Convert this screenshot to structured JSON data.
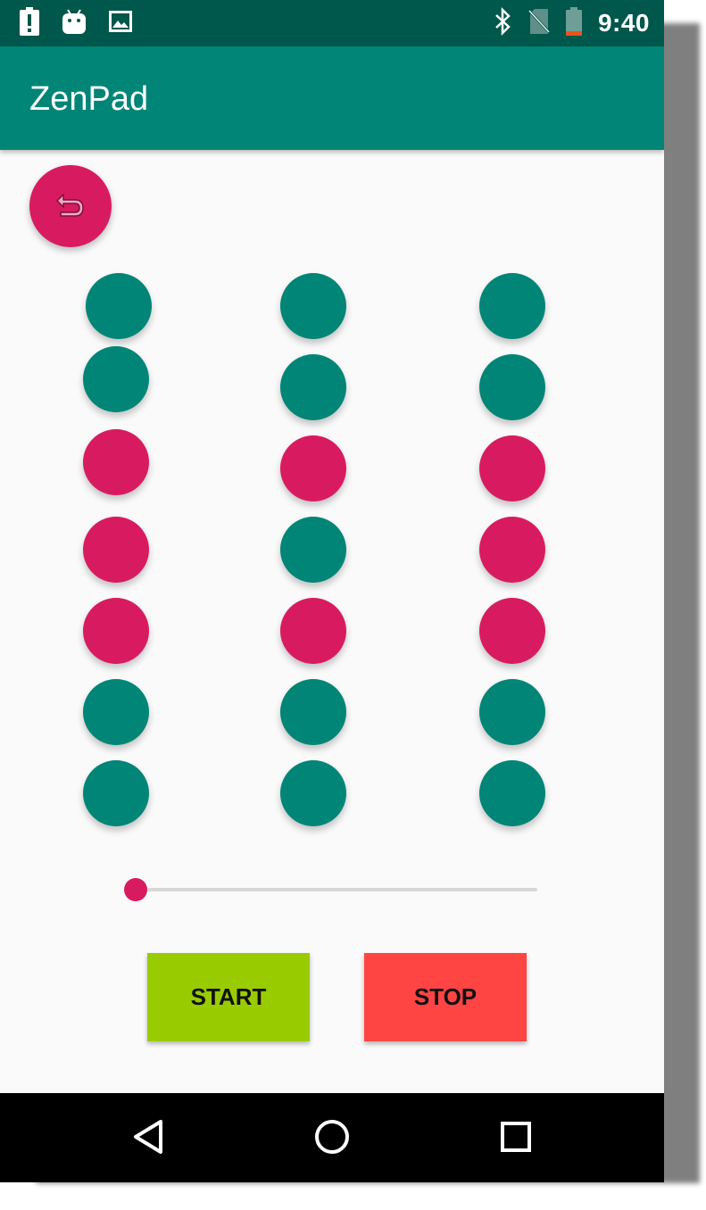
{
  "status_bar": {
    "time": "9:40",
    "left_icons": [
      "battery-alert-icon",
      "android-icon",
      "image-icon"
    ],
    "right_icons": [
      "bluetooth-icon",
      "no-sim-icon",
      "battery-low-icon"
    ]
  },
  "app_bar": {
    "title": "ZenPad"
  },
  "undo_button": {
    "icon": "undo-icon"
  },
  "colors": {
    "teal": "#008577",
    "pink": "#d81b60",
    "start": "#99cc00",
    "stop": "#ff4444"
  },
  "grid": {
    "columns": 3,
    "rows": 7,
    "pattern": [
      [
        "teal",
        "teal",
        "teal"
      ],
      [
        "teal",
        "teal",
        "teal"
      ],
      [
        "pink",
        "pink",
        "pink"
      ],
      [
        "pink",
        "teal",
        "pink"
      ],
      [
        "pink",
        "pink",
        "pink"
      ],
      [
        "teal",
        "teal",
        "teal"
      ],
      [
        "teal",
        "teal",
        "teal"
      ]
    ]
  },
  "slider": {
    "value": 0
  },
  "buttons": {
    "start_label": "START",
    "stop_label": "STOP"
  },
  "nav_bar": {
    "icons": [
      "back-icon",
      "home-icon",
      "recents-icon"
    ]
  }
}
